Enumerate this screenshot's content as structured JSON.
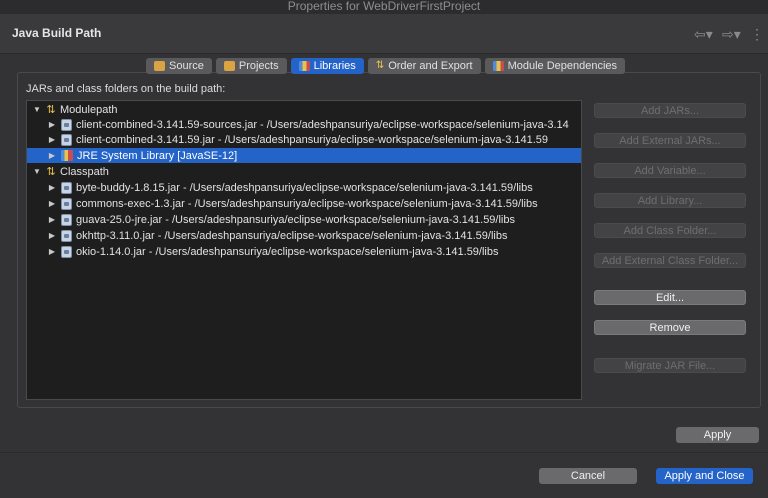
{
  "window": {
    "title": "Properties for WebDriverFirstProject"
  },
  "header": {
    "title": "Java Build Path",
    "back_icon": "arrow-left-icon",
    "forward_icon": "arrow-right-icon",
    "menu_icon": "more-icon"
  },
  "tabs": [
    {
      "label": "Source",
      "icon": "folder-icon"
    },
    {
      "label": "Projects",
      "icon": "projects-icon"
    },
    {
      "label": "Libraries",
      "icon": "libraries-icon",
      "active": true
    },
    {
      "label": "Order and Export",
      "icon": "order-icon"
    },
    {
      "label": "Module Dependencies",
      "icon": "module-icon"
    }
  ],
  "panel": {
    "label": "JARs and class folders on the build path:"
  },
  "tree": {
    "modulepath": {
      "label": "Modulepath",
      "items": [
        "client-combined-3.141.59-sources.jar - /Users/adeshpansuriya/eclipse-workspace/selenium-java-3.14",
        "client-combined-3.141.59.jar - /Users/adeshpansuriya/eclipse-workspace/selenium-java-3.141.59",
        "JRE System Library [JavaSE-12]"
      ]
    },
    "classpath": {
      "label": "Classpath",
      "items": [
        "byte-buddy-1.8.15.jar - /Users/adeshpansuriya/eclipse-workspace/selenium-java-3.141.59/libs",
        "commons-exec-1.3.jar - /Users/adeshpansuriya/eclipse-workspace/selenium-java-3.141.59/libs",
        "guava-25.0-jre.jar - /Users/adeshpansuriya/eclipse-workspace/selenium-java-3.141.59/libs",
        "okhttp-3.11.0.jar - /Users/adeshpansuriya/eclipse-workspace/selenium-java-3.141.59/libs",
        "okio-1.14.0.jar - /Users/adeshpansuriya/eclipse-workspace/selenium-java-3.141.59/libs"
      ]
    }
  },
  "buttons": {
    "add_jars": "Add JARs...",
    "add_external_jars": "Add External JARs...",
    "add_variable": "Add Variable...",
    "add_library": "Add Library...",
    "add_class_folder": "Add Class Folder...",
    "add_external_class_folder": "Add External Class Folder...",
    "edit": "Edit...",
    "remove": "Remove",
    "migrate_jar": "Migrate JAR File..."
  },
  "footer": {
    "apply": "Apply",
    "cancel": "Cancel",
    "apply_close": "Apply and Close"
  },
  "colors": {
    "accent": "#2463c7",
    "background": "#333335",
    "tree_bg": "#1e1e1e"
  }
}
